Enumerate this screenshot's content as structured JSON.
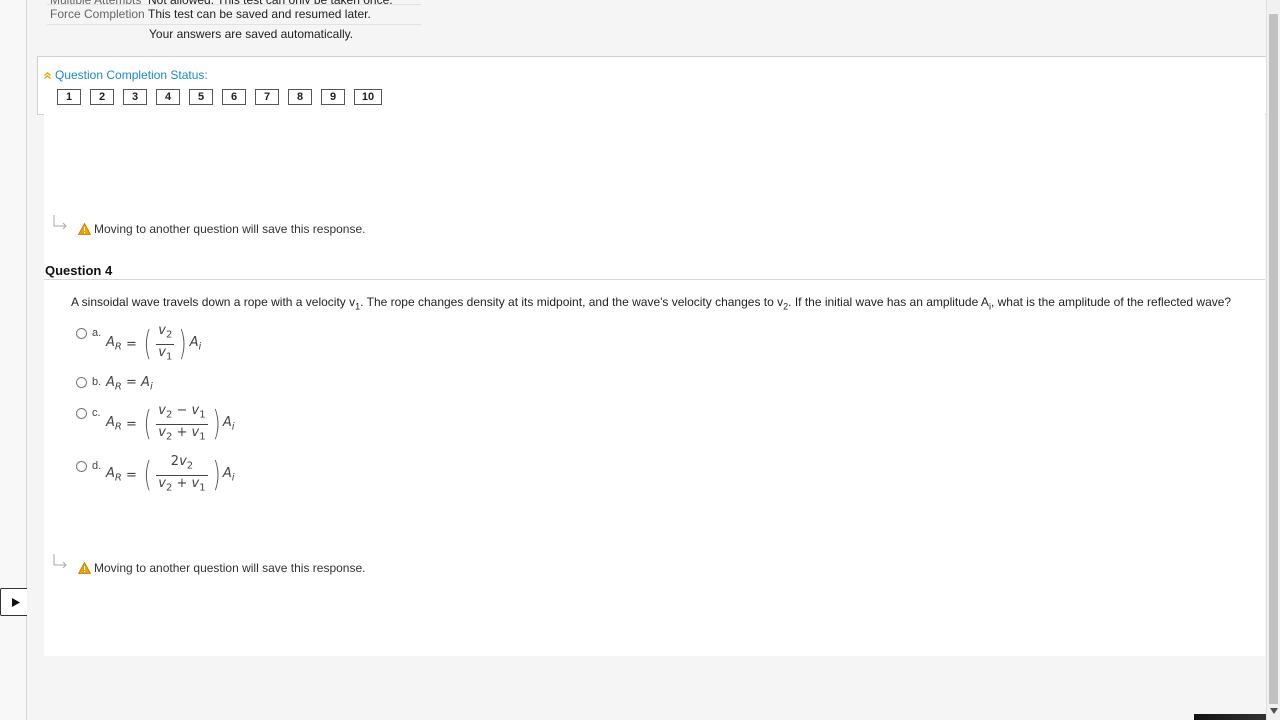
{
  "info": {
    "rows": [
      {
        "label": "Multiple Attempts",
        "value": "Not allowed. This test can only be taken once."
      },
      {
        "label": "Force Completion",
        "value": "This test can be saved and resumed later."
      }
    ],
    "extra": "Your answers are saved automatically."
  },
  "status": {
    "header": "Question Completion Status:",
    "questions": [
      "1",
      "2",
      "3",
      "4",
      "5",
      "6",
      "7",
      "8",
      "9",
      "10"
    ]
  },
  "save_note": "Moving to another question will save this response.",
  "question": {
    "title": "Question 4",
    "text_1": "A sinsoidal wave travels down a rope with a velocity v",
    "sub_1": "1",
    "text_2": ". The rope changes density at its midpoint, and the wave's velocity changes to v",
    "sub_2": "2",
    "text_3": ". If the initial wave has an amplitude A",
    "sub_3": "i",
    "text_4": ", what is the amplitude of the reflected wave?",
    "options": [
      {
        "letter": "a."
      },
      {
        "letter": "b."
      },
      {
        "letter": "c."
      },
      {
        "letter": "d."
      }
    ]
  },
  "icons": {
    "menu_toggle": "play-triangle-icon",
    "status_collapse": "double-chevron-up-icon",
    "warning": "warning-triangle-icon",
    "arrow": "return-arrow-icon"
  },
  "colors": {
    "link": "#1a88c9",
    "warning": "#f0a000"
  }
}
